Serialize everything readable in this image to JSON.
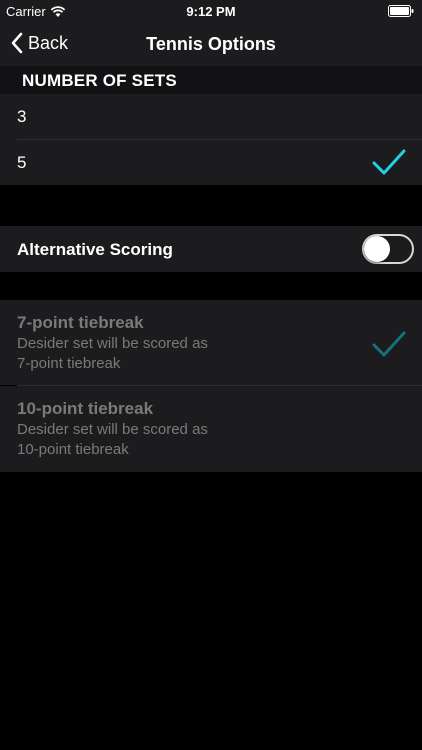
{
  "status_bar": {
    "carrier": "Carrier",
    "time": "9:12 PM"
  },
  "nav": {
    "back_label": "Back",
    "title": "Tennis Options"
  },
  "sets_section": {
    "header": "NUMBER OF SETS",
    "options": [
      {
        "label": "3",
        "selected": false
      },
      {
        "label": "5",
        "selected": true
      }
    ]
  },
  "alternative_scoring": {
    "label": "Alternative Scoring",
    "enabled": false
  },
  "tiebreak_section": {
    "options": [
      {
        "title": "7-point tiebreak",
        "subtitle": "Desider set will be scored as\n7-point tiebreak",
        "selected": true
      },
      {
        "title": "10-point tiebreak",
        "subtitle": "Desider set will be scored as\n10-point tiebreak",
        "selected": false
      }
    ]
  },
  "colors": {
    "accent": "#1fd2e6",
    "accent_disabled": "#15727c",
    "background": "#000000",
    "cell": "#1c1c1e"
  }
}
